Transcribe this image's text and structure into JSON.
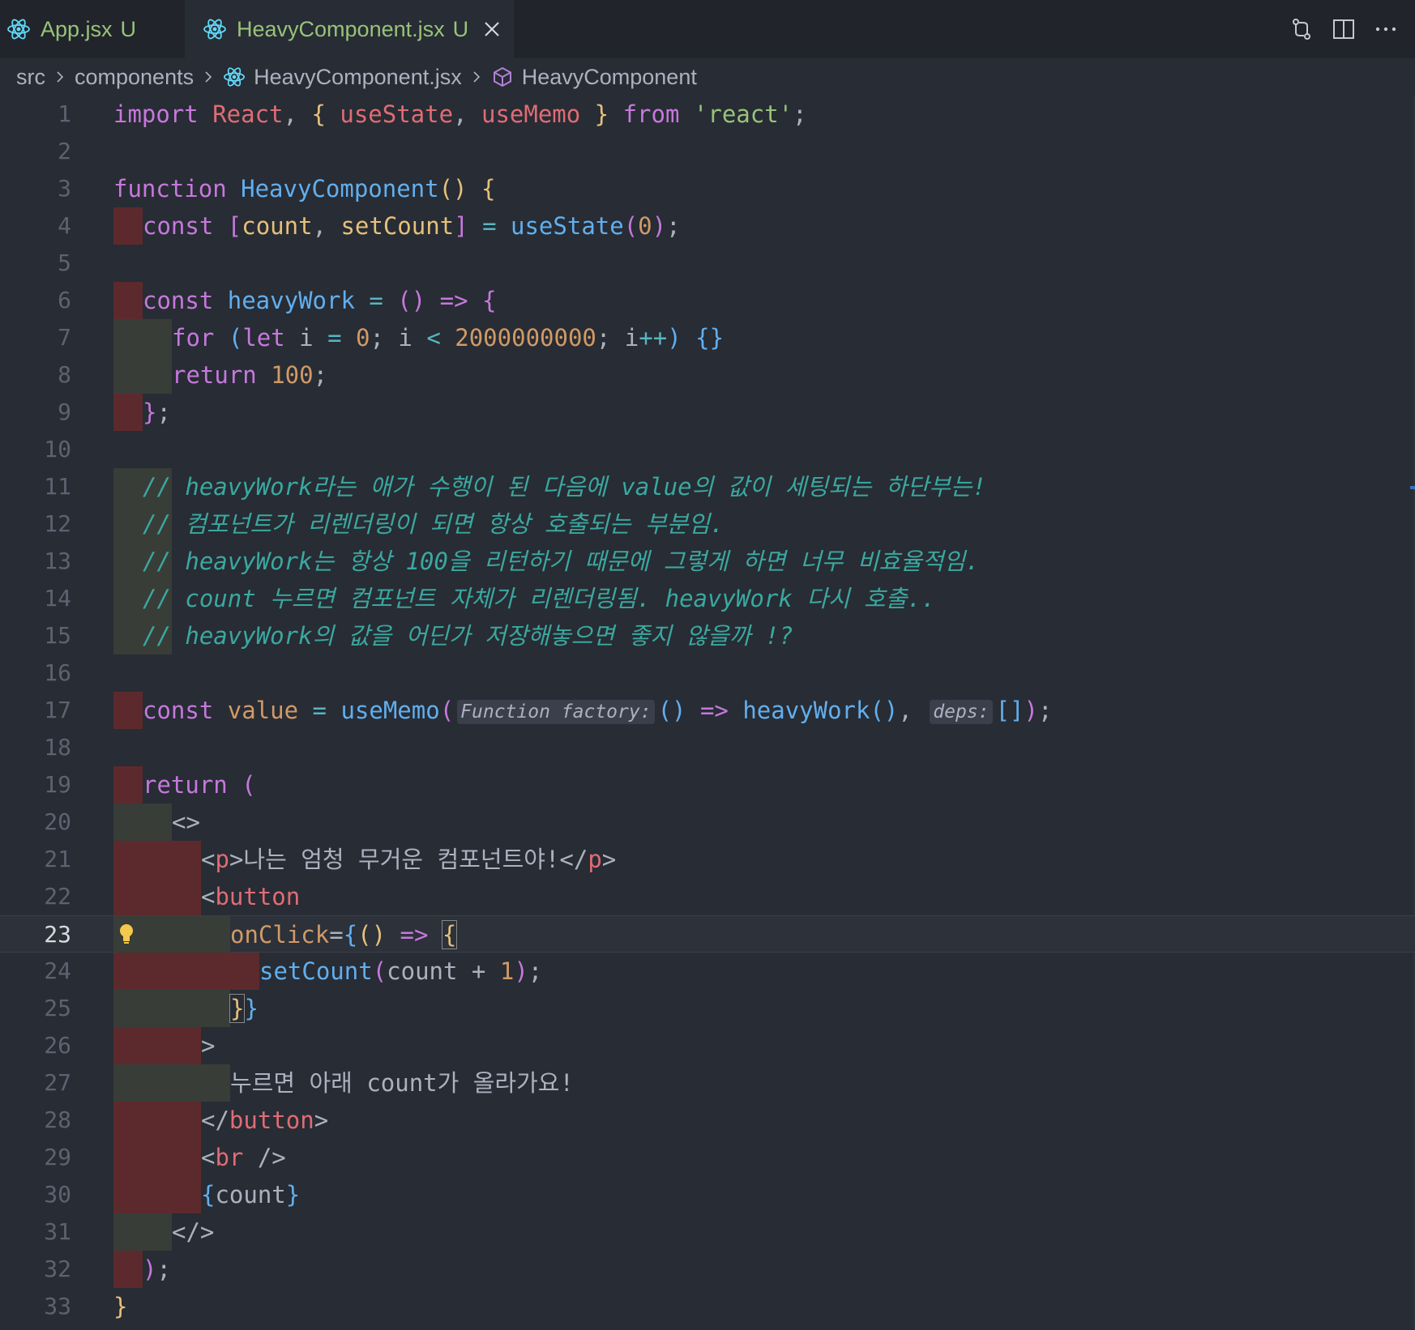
{
  "tabs": [
    {
      "label": "App.jsx",
      "status": "U",
      "active": false
    },
    {
      "label": "HeavyComponent.jsx",
      "status": "U",
      "active": true
    }
  ],
  "toolbar_icons": [
    "compare-changes-icon",
    "split-editor-icon",
    "more-actions-icon"
  ],
  "breadcrumb": {
    "items": [
      "src",
      "components",
      "HeavyComponent.jsx",
      "HeavyComponent"
    ]
  },
  "editor": {
    "current_line": 23,
    "line_numbers": [
      "1",
      "2",
      "3",
      "4",
      "5",
      "6",
      "7",
      "8",
      "9",
      "10",
      "11",
      "12",
      "13",
      "14",
      "15",
      "16",
      "17",
      "18",
      "19",
      "20",
      "21",
      "22",
      "23",
      "24",
      "25",
      "26",
      "27",
      "28",
      "29",
      "30",
      "31",
      "32",
      "33"
    ],
    "lines": {
      "l1": {
        "t1": "import ",
        "t2": "React",
        ",": ", ",
        "t3": "{ ",
        "t4": "useState",
        ",2": ", ",
        "t5": "useMemo",
        "t6": " } ",
        "t7": "from ",
        "t8": "'react'",
        "t9": ";"
      },
      "l3": {
        "t1": "function ",
        "t2": "HeavyComponent",
        "t3": "()",
        "t4": " {"
      },
      "l4": {
        "t1": "const ",
        "t2": "[",
        "t3": "count",
        ",": ", ",
        "t4": "setCount",
        "t5": "]",
        "t6": " = ",
        "t7": "useState",
        "t8": "(",
        "t9": "0",
        "t10": ")",
        "t11": ";"
      },
      "l6": {
        "t1": "const ",
        "t2": "heavyWork",
        "t3": " = ",
        "t4": "()",
        "t5": " => ",
        "t6": "{"
      },
      "l7": {
        "t1": "for ",
        "t2": "(",
        "t3": "let ",
        "t4": "i",
        " = ": " = ",
        "t5": "0",
        "t6": "; i ",
        "t7": "<",
        "t8": " ",
        "t9": "2000000000",
        "t10": "; i",
        "t11": "++",
        "t12": ") ",
        "t13": "{}"
      },
      "l8": {
        "t1": "return ",
        "t2": "100",
        "t3": ";"
      },
      "l9": {
        "t1": "}",
        "t2": ";"
      },
      "l11": {
        "t1": "// heavyWork라는 애가 수행이 된 다음에 value의 값이 세팅되는 하단부는!"
      },
      "l12": {
        "t1": "// 컴포넌트가 리렌더링이 되면 항상 호출되는 부분임."
      },
      "l13": {
        "t1": "// heavyWork는 항상 100을 리턴하기 때문에 그렇게 하면 너무 비효율적임."
      },
      "l14": {
        "t1": "// count 누르면 컴포넌트 자체가 리렌더링됨. heavyWork 다시 호출.."
      },
      "l15": {
        "t1": "// heavyWork의 값을 어딘가 저장해놓으면 좋지 않을까 !?"
      },
      "l17": {
        "t1": "const ",
        "t2": "value",
        "t3": " = ",
        "t4": "useMemo",
        "t5": "(",
        "hint1": "Function factory:",
        "t6": "()",
        "t7": " => ",
        "t8": "heavyWork",
        "t9": "()",
        "t10": ", ",
        "hint2": "deps:",
        "t11": "[]",
        "t12": ")",
        "t13": ";"
      },
      "l19": {
        "t1": "return ",
        "t2": "("
      },
      "l20": {
        "t1": "<>"
      },
      "l21": {
        "t1": "<",
        "t2": "p",
        "t3": ">나는 엄청 무거운 컴포넌트야!</",
        "t4": "p",
        "t5": ">"
      },
      "l22": {
        "t1": "<",
        "t2": "button"
      },
      "l23": {
        "t1": "onClick",
        "t2": "=",
        "t3": "{",
        "t4": "()",
        "t5": " => ",
        "t6": "{"
      },
      "l24": {
        "t1": "setCount",
        "t2": "(",
        "t3": "count + ",
        "t4": "1",
        "t5": ")",
        "t6": ";"
      },
      "l25": {
        "t1": "}",
        "t2": "}"
      },
      "l26": {
        "t1": ">"
      },
      "l27": {
        "t1": "누르면 아래 count가 올라가요!"
      },
      "l28": {
        "t1": "</",
        "t2": "button",
        "t3": ">"
      },
      "l29": {
        "t1": "<",
        "t2": "br",
        "t3": " />"
      },
      "l30": {
        "t1": "{",
        "t2": "count",
        "t3": "}"
      },
      "l31": {
        "t1": "</>"
      },
      "l32": {
        "t1": ")",
        "t2": ";"
      },
      "l33": {
        "t1": "}"
      }
    }
  },
  "colors": {
    "background": "#282c34",
    "tabbar": "#21252b",
    "indent_red": "#5c2a2d",
    "indent_gray": "#393d38",
    "comment": "#3aa8a0"
  }
}
